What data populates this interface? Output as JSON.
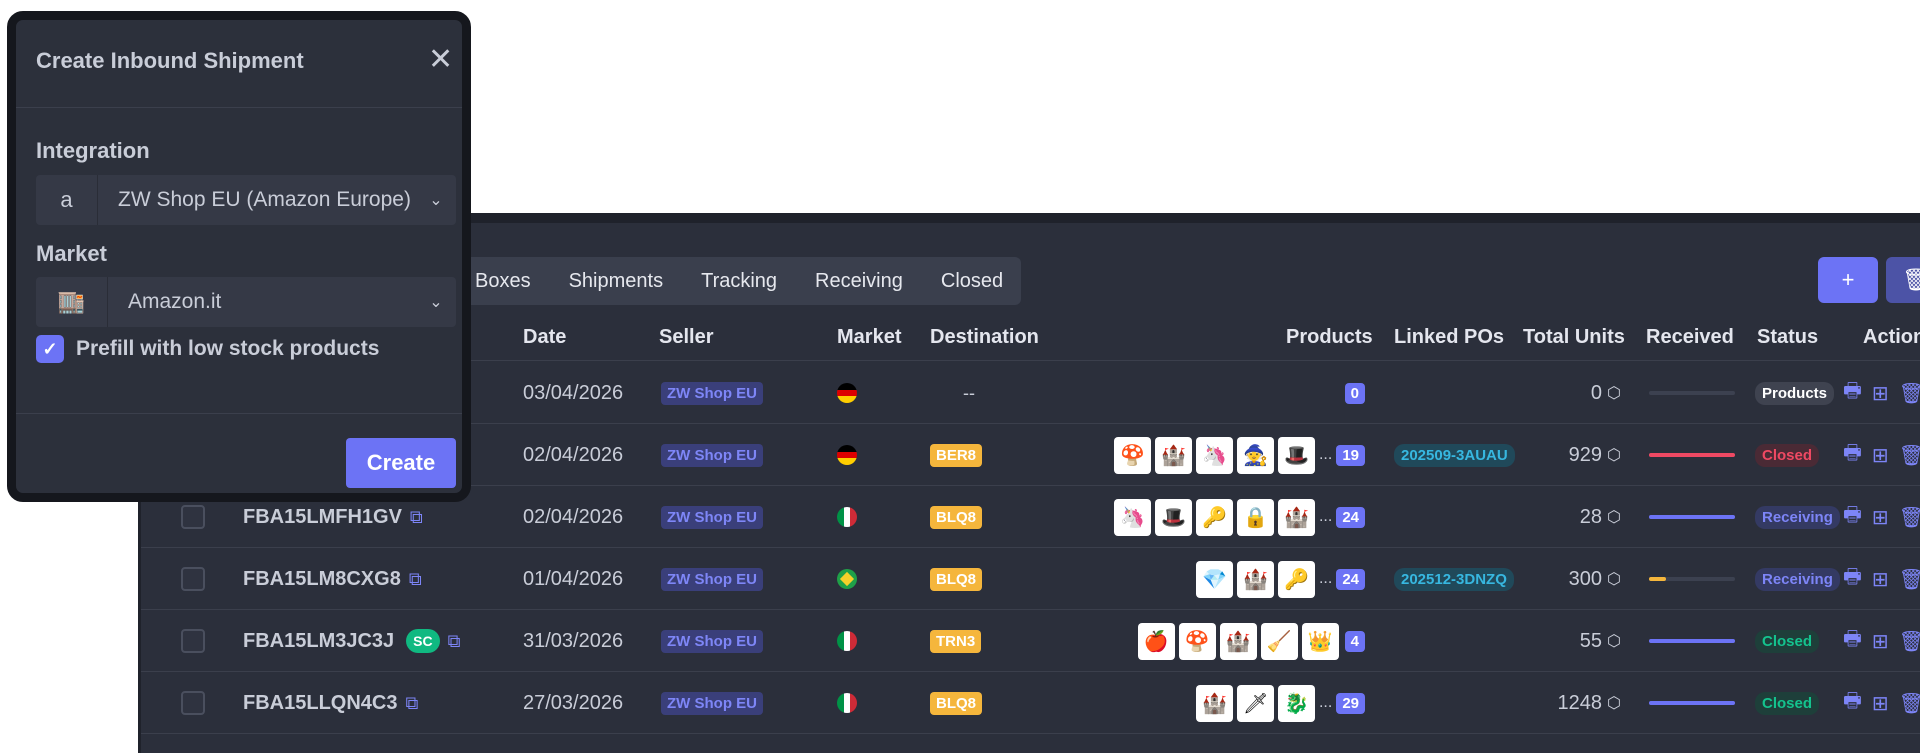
{
  "tabs": [
    "Boxes",
    "Shipments",
    "Tracking",
    "Receiving",
    "Closed"
  ],
  "toolbar": {
    "add_label": "+",
    "delete_label": "🗑"
  },
  "columns": {
    "date": "Date",
    "seller": "Seller",
    "market": "Market",
    "destination": "Destination",
    "products": "Products",
    "linked_pos": "Linked POs",
    "total_units": "Total Units",
    "received": "Received",
    "status": "Status",
    "actions": "Action"
  },
  "rows": [
    {
      "id": "",
      "date": "03/04/2026",
      "seller": "ZW Shop EU",
      "market": "de",
      "destination": "--",
      "products_count": "0",
      "linked_po": "",
      "units": "0",
      "received_fraction": 0,
      "status": "Products"
    },
    {
      "id": "",
      "date": "02/04/2026",
      "seller": "ZW Shop EU",
      "market": "de",
      "destination": "BER8",
      "products_count": "19",
      "linked_po": "202509-3AUAU",
      "units": "929",
      "received_fraction": 1,
      "status": "Closed"
    },
    {
      "id": "FBA15LMFH1GV",
      "date": "02/04/2026",
      "seller": "ZW Shop EU",
      "market": "it",
      "destination": "BLQ8",
      "products_count": "24",
      "linked_po": "",
      "units": "28",
      "received_fraction": 1,
      "status": "Receiving"
    },
    {
      "id": "FBA15LM8CXG8",
      "date": "01/04/2026",
      "seller": "ZW Shop EU",
      "market": "br",
      "destination": "BLQ8",
      "products_count": "24",
      "linked_po": "202512-3DNZQ",
      "units": "300",
      "received_fraction": 0.2,
      "status": "Receiving"
    },
    {
      "id": "FBA15LM3JC3J",
      "badge": "SC",
      "date": "31/03/2026",
      "seller": "ZW Shop EU",
      "market": "it",
      "destination": "TRN3",
      "products_count": "4",
      "linked_po": "",
      "units": "55",
      "received_fraction": 1,
      "status": "Closed"
    },
    {
      "id": "FBA15LLQN4C3",
      "date": "27/03/2026",
      "seller": "ZW Shop EU",
      "market": "it",
      "destination": "BLQ8",
      "products_count": "29",
      "linked_po": "",
      "units": "1248",
      "received_fraction": 1,
      "status": "Closed"
    }
  ],
  "colors": {
    "accent": "#6c73f5",
    "red": "#ef4963",
    "orange": "#f5b63c",
    "green": "#14c38e"
  },
  "modal": {
    "title": "Create Inbound Shipment",
    "integration_label": "Integration",
    "integration_value": "ZW Shop EU (Amazon Europe)",
    "market_label": "Market",
    "market_value": "Amazon.it",
    "prefill_label": "Prefill with low stock products",
    "prefill_checked": true,
    "create_label": "Create"
  }
}
